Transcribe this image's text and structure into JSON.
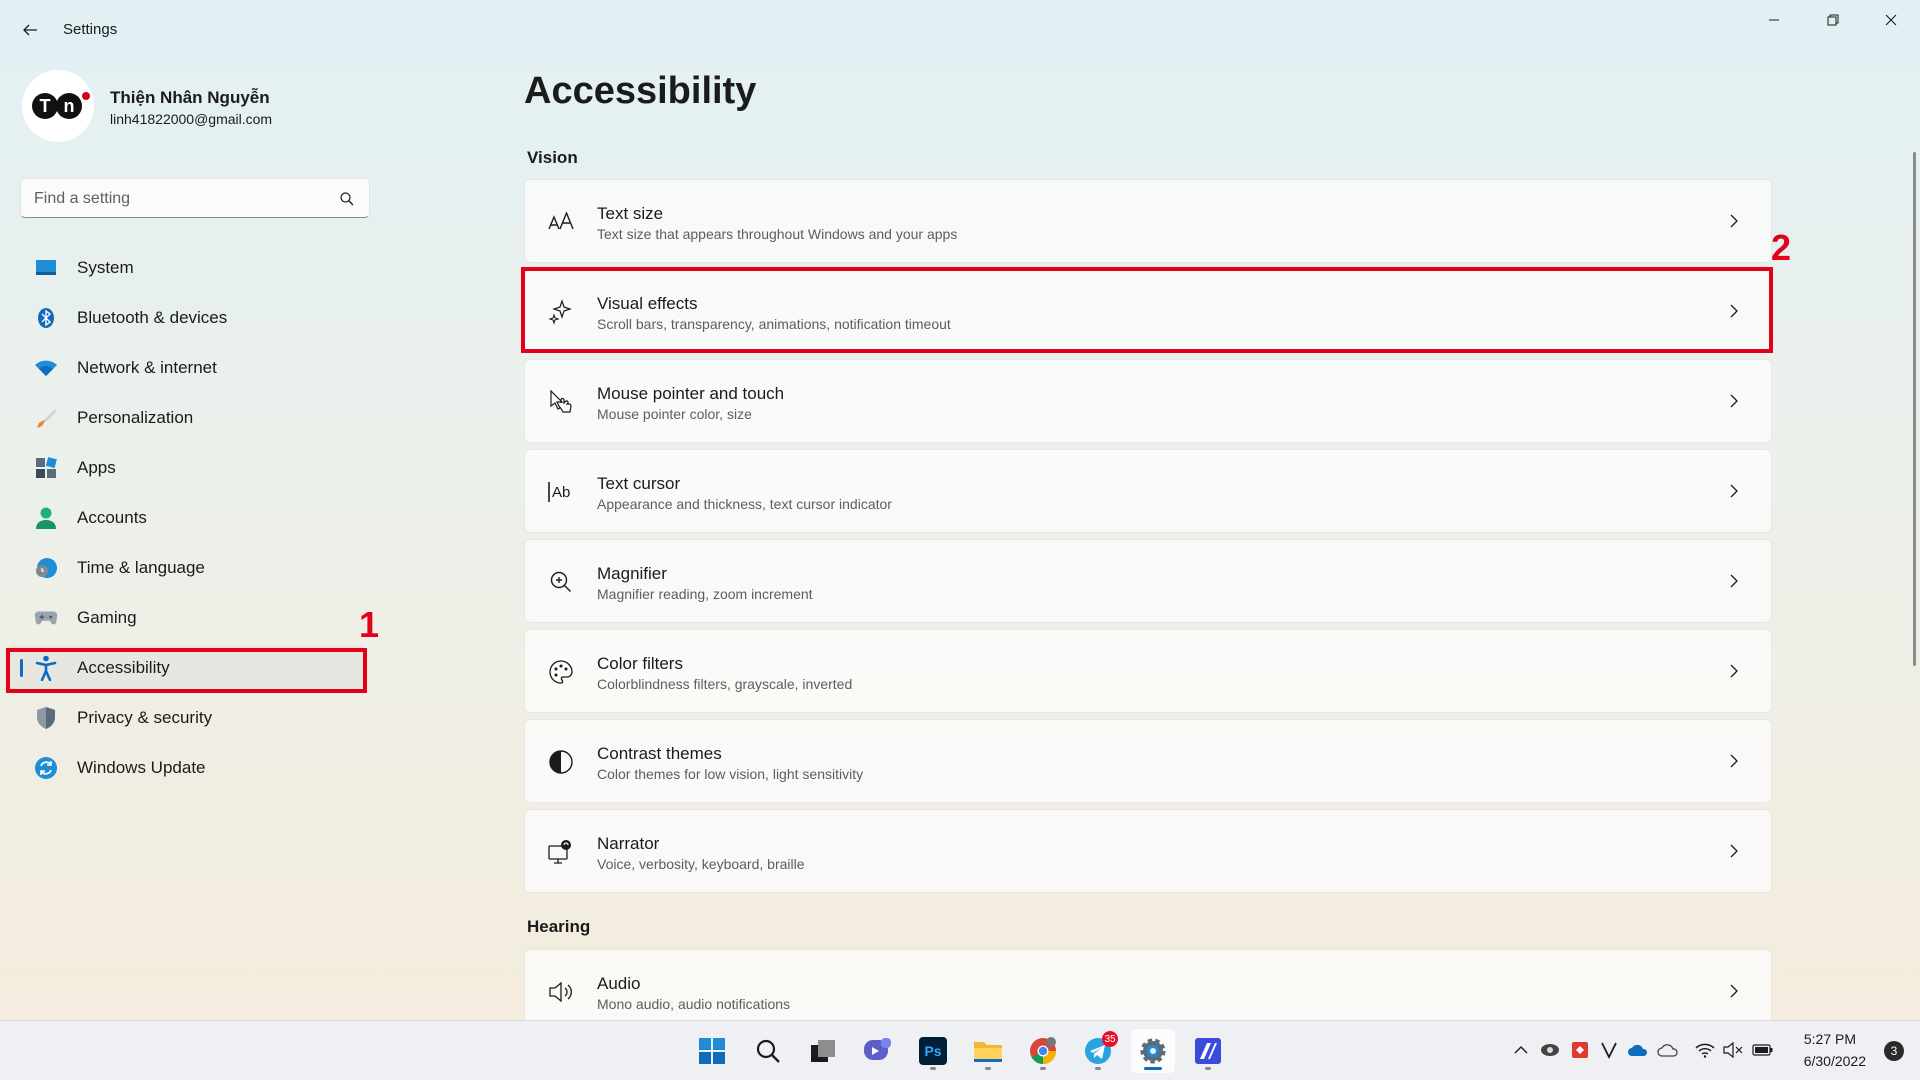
{
  "window": {
    "title": "Settings"
  },
  "profile": {
    "initials": "TN",
    "name": "Thiện Nhân Nguyễn",
    "email": "linh41822000@gmail.com"
  },
  "search": {
    "placeholder": "Find a setting",
    "value": ""
  },
  "sidebar": {
    "items": [
      {
        "label": "System",
        "icon": "system-icon"
      },
      {
        "label": "Bluetooth & devices",
        "icon": "bluetooth-icon"
      },
      {
        "label": "Network & internet",
        "icon": "wifi-icon"
      },
      {
        "label": "Personalization",
        "icon": "brush-icon"
      },
      {
        "label": "Apps",
        "icon": "apps-icon"
      },
      {
        "label": "Accounts",
        "icon": "person-icon"
      },
      {
        "label": "Time & language",
        "icon": "clock-globe-icon"
      },
      {
        "label": "Gaming",
        "icon": "gamepad-icon"
      },
      {
        "label": "Accessibility",
        "icon": "accessibility-icon",
        "selected": true
      },
      {
        "label": "Privacy & security",
        "icon": "shield-icon"
      },
      {
        "label": "Windows Update",
        "icon": "update-icon"
      }
    ]
  },
  "annotations": {
    "marker1": "1",
    "marker2": "2",
    "color": "#e3001b"
  },
  "main": {
    "title": "Accessibility",
    "sections": [
      {
        "label": "Vision",
        "items": [
          {
            "title": "Text size",
            "subtitle": "Text size that appears throughout Windows and your apps",
            "icon": "text-size-icon"
          },
          {
            "title": "Visual effects",
            "subtitle": "Scroll bars, transparency, animations, notification timeout",
            "icon": "sparkle-icon"
          },
          {
            "title": "Mouse pointer and touch",
            "subtitle": "Mouse pointer color, size",
            "icon": "pointer-icon"
          },
          {
            "title": "Text cursor",
            "subtitle": "Appearance and thickness, text cursor indicator",
            "icon": "text-cursor-icon"
          },
          {
            "title": "Magnifier",
            "subtitle": "Magnifier reading, zoom increment",
            "icon": "magnifier-icon"
          },
          {
            "title": "Color filters",
            "subtitle": "Colorblindness filters, grayscale, inverted",
            "icon": "palette-icon"
          },
          {
            "title": "Contrast themes",
            "subtitle": "Color themes for low vision, light sensitivity",
            "icon": "contrast-icon"
          },
          {
            "title": "Narrator",
            "subtitle": "Voice, verbosity, keyboard, braille",
            "icon": "narrator-icon"
          }
        ]
      },
      {
        "label": "Hearing",
        "items": [
          {
            "title": "Audio",
            "subtitle": "Mono audio, audio notifications",
            "icon": "speaker-icon"
          }
        ]
      }
    ]
  },
  "taskbar": {
    "apps": [
      "start-icon",
      "search-icon",
      "task-view-icon",
      "chat-icon",
      "photoshop-icon",
      "file-explorer-icon",
      "chrome-icon",
      "telegram-icon",
      "settings-icon",
      "app-icon"
    ],
    "telegram_badge": "35",
    "photoshop_label": "Ps",
    "time": "5:27 PM",
    "date": "6/30/2022",
    "notifications": "3"
  },
  "colors": {
    "accent": "#0f6cbd",
    "highlight": "#e3001b"
  }
}
